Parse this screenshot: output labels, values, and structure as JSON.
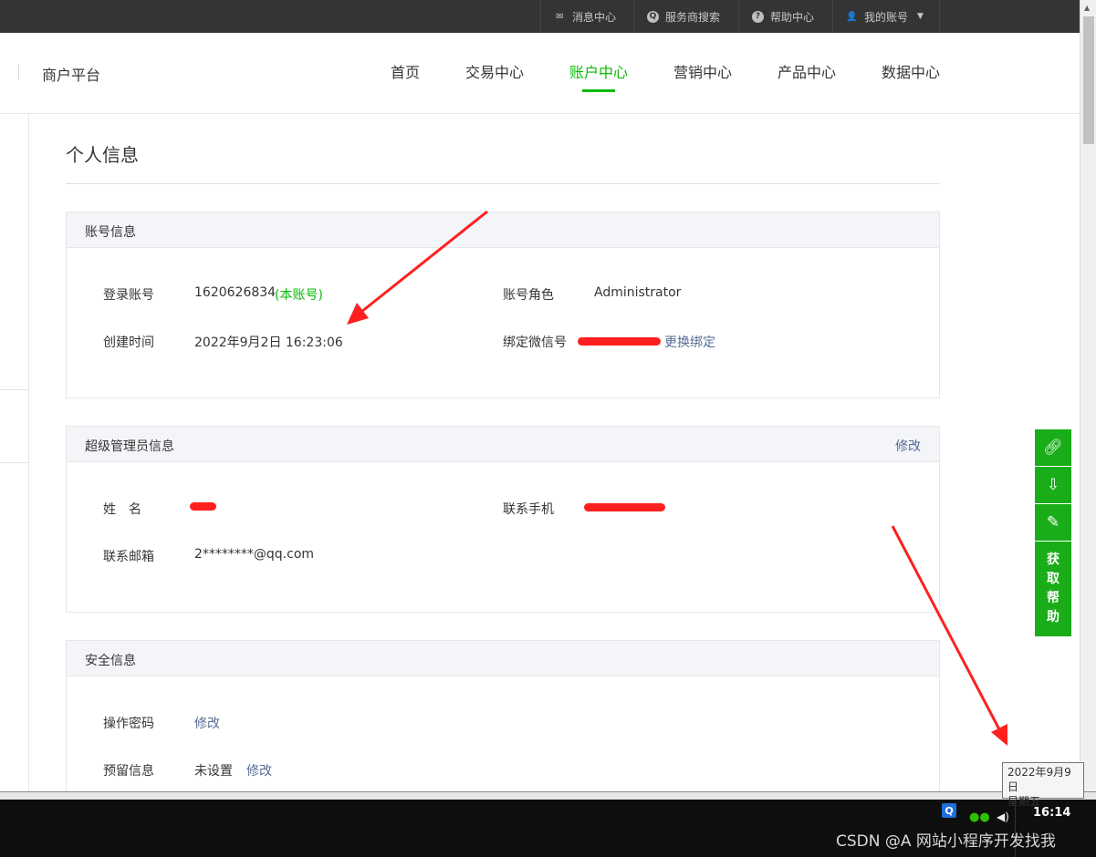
{
  "topbar": {
    "messages": "消息中心",
    "provider_search": "服务商搜索",
    "help": "帮助中心",
    "account": "我的账号"
  },
  "header": {
    "brand": "商户平台",
    "nav": [
      "首页",
      "交易中心",
      "账户中心",
      "营销中心",
      "产品中心",
      "数据中心"
    ],
    "active_nav": "账户中心"
  },
  "page": {
    "title": "个人信息"
  },
  "account_info": {
    "title": "账号信息",
    "login_label": "登录账号",
    "login_value": "1620626834",
    "login_tag": "(本账号)",
    "role_label": "账号角色",
    "role_value": "Administrator",
    "created_label": "创建时间",
    "created_value": "2022年9月2日 16:23:06",
    "wechat_label": "绑定微信号",
    "wechat_change": "更换绑定"
  },
  "admin_info": {
    "title": "超级管理员信息",
    "edit": "修改",
    "name_label": "姓　名",
    "phone_label": "联系手机",
    "email_label": "联系邮箱",
    "email_value": "2********@qq.com"
  },
  "security_info": {
    "title": "安全信息",
    "password_label": "操作密码",
    "password_edit": "修改",
    "reserved_label": "预留信息",
    "reserved_value": "未设置",
    "reserved_edit": "修改"
  },
  "float_tools": {
    "help": [
      "获",
      "取",
      "帮",
      "助"
    ]
  },
  "tooltip": {
    "date": "2022年9月9日",
    "weekday": "星期五"
  },
  "taskbar": {
    "time": "16:14",
    "watermark": "CSDN @A 网站小程序开发找我"
  },
  "colors": {
    "accent": "#09bb07",
    "link": "#576b95",
    "annotation": "#ff1f1f"
  }
}
